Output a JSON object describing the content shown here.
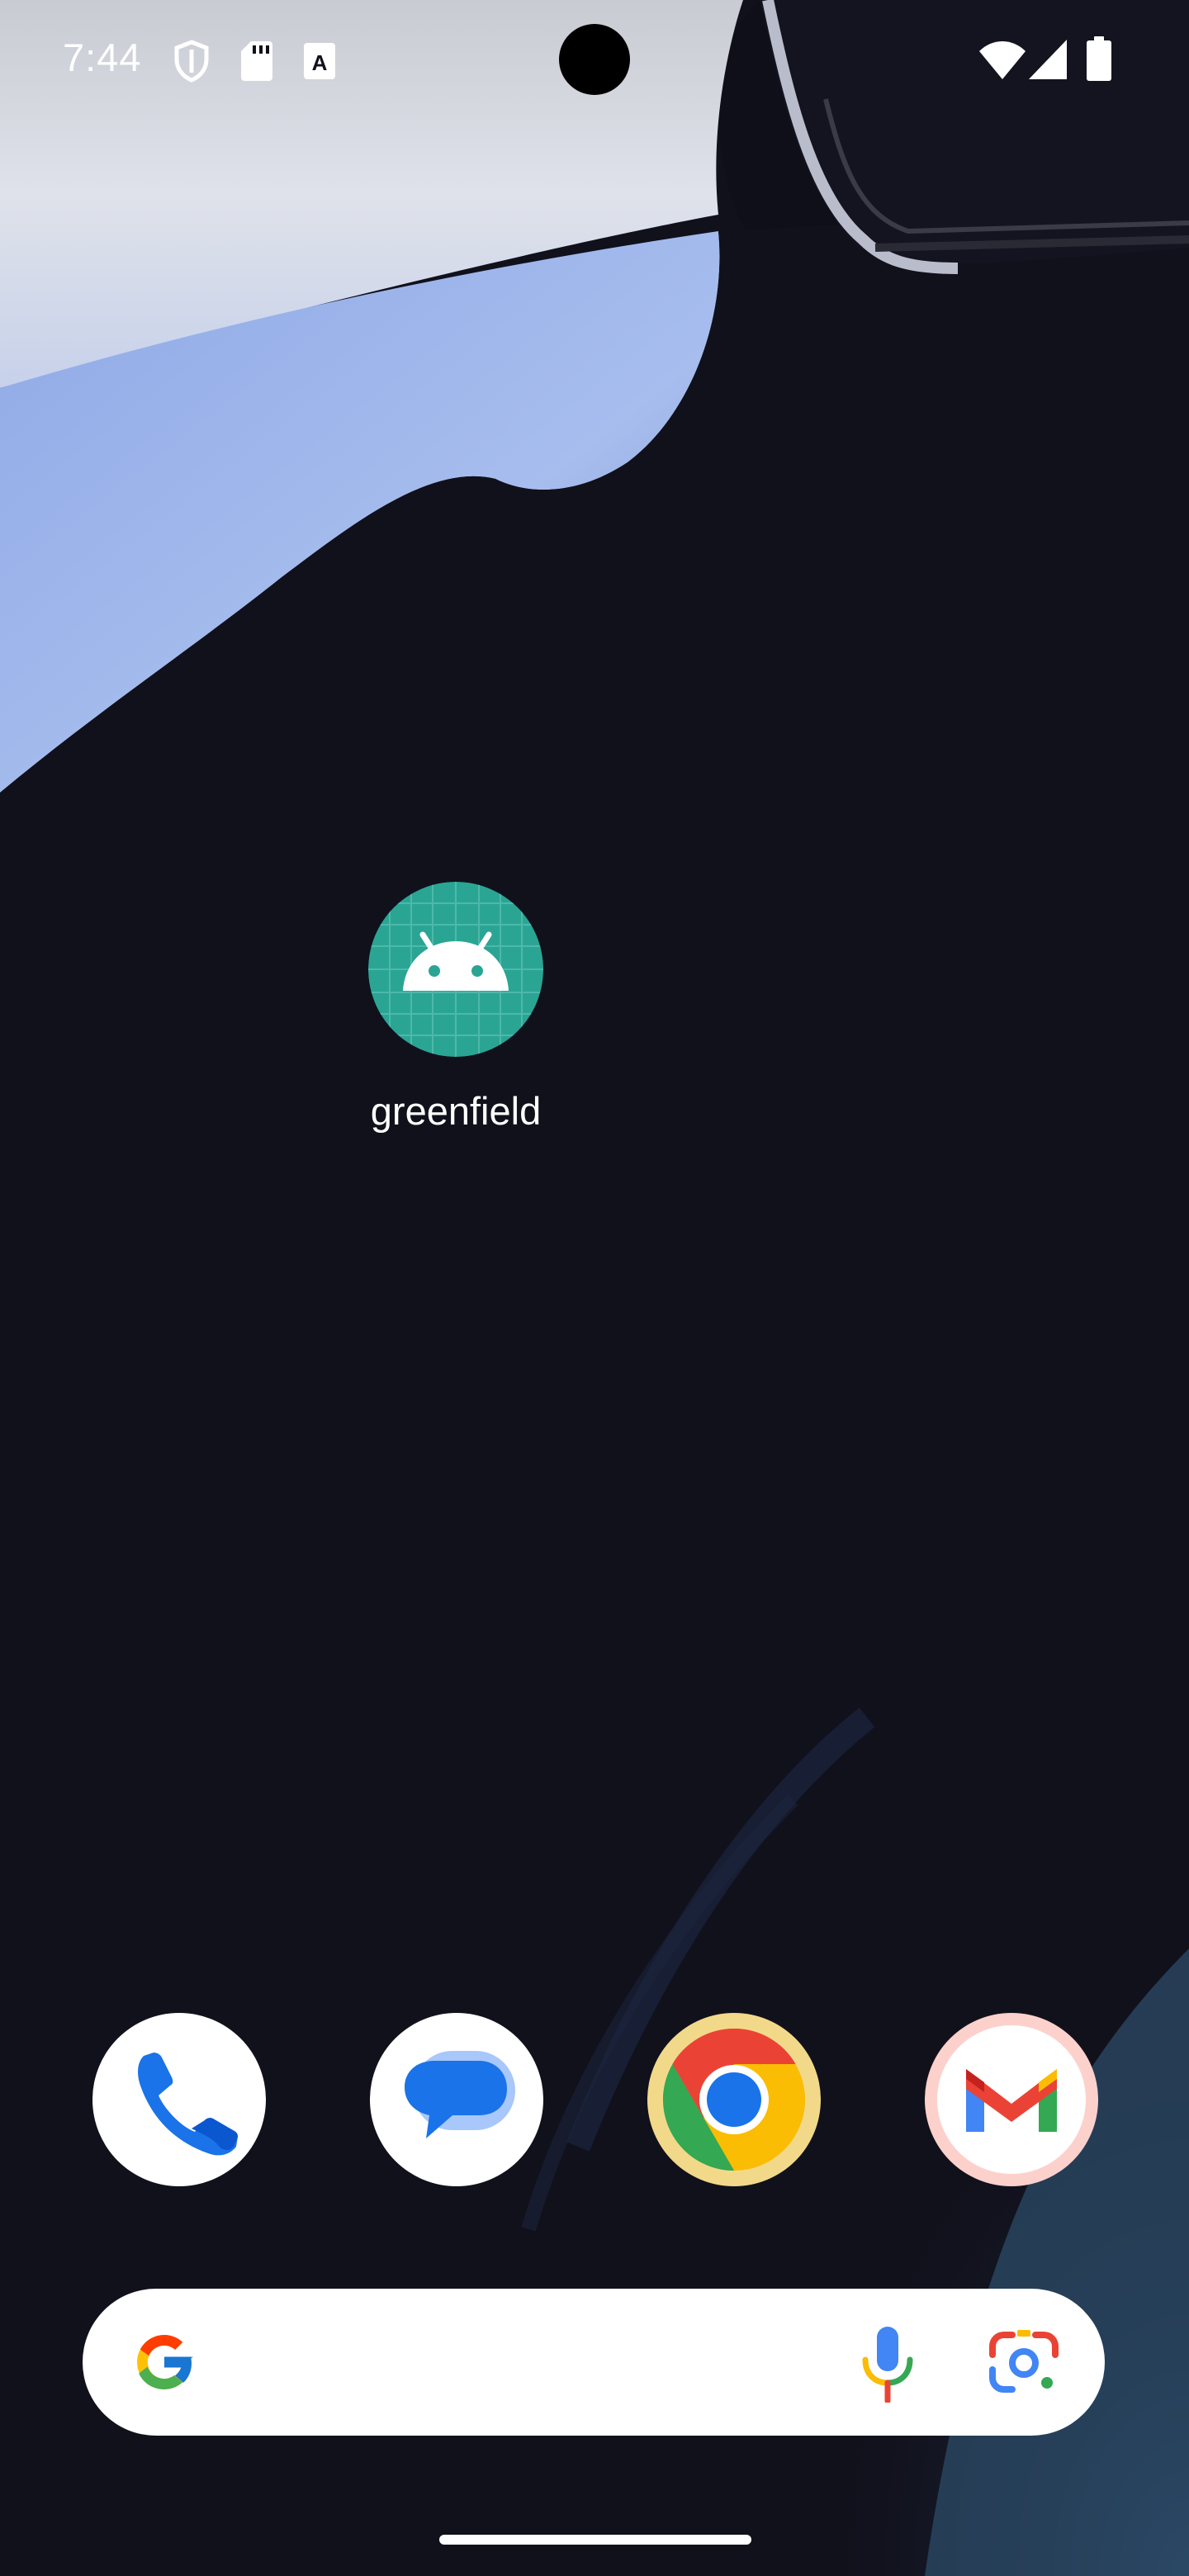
{
  "status_bar": {
    "time": "7:44",
    "left_icons": [
      "vpn-shield-icon",
      "sd-card-icon",
      "keyboard-a-icon"
    ],
    "right_icons": [
      "wifi-icon",
      "cellular-signal-icon",
      "battery-icon"
    ]
  },
  "home_screen": {
    "apps": [
      {
        "label": "greenfield",
        "icon": "android-icon",
        "icon_color": "#2aa594"
      }
    ]
  },
  "dock": {
    "apps": [
      {
        "name": "Phone",
        "icon": "phone-icon"
      },
      {
        "name": "Messages",
        "icon": "messages-icon"
      },
      {
        "name": "Chrome",
        "icon": "chrome-icon"
      },
      {
        "name": "Gmail",
        "icon": "gmail-icon"
      }
    ]
  },
  "search_bar": {
    "icons": [
      "google-g-icon",
      "microphone-icon",
      "google-lens-icon"
    ]
  },
  "colors": {
    "wallpaper_dark": "#11111c",
    "wallpaper_light": "#a9bfea",
    "app_icon_teal": "#2aa594"
  }
}
